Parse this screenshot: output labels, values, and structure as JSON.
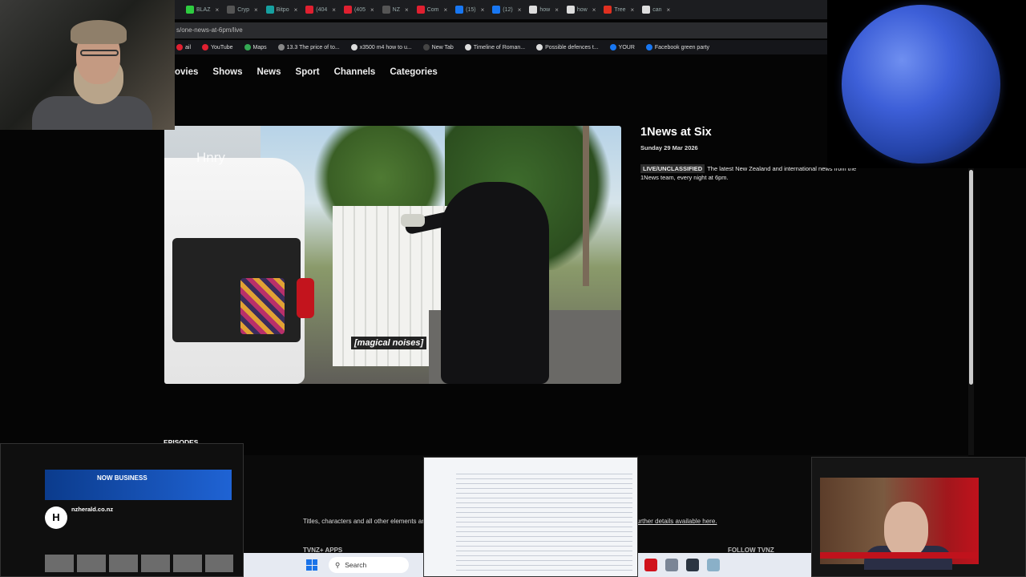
{
  "browser": {
    "tabs": [
      {
        "label": "BLAZ",
        "color": "#2ecc40"
      },
      {
        "label": "Cryp",
        "color": "#555555"
      },
      {
        "label": "Bitpo",
        "color": "#16a0a0"
      },
      {
        "label": "(404",
        "color": "#e02030"
      },
      {
        "label": "(405",
        "color": "#e02030"
      },
      {
        "label": "NZ",
        "color": "#555555"
      },
      {
        "label": "Com",
        "color": "#e02030"
      },
      {
        "label": "(15)",
        "color": "#1877f2"
      },
      {
        "label": "(12)",
        "color": "#1877f2"
      },
      {
        "label": "how",
        "color": "#dddddd"
      },
      {
        "label": "how",
        "color": "#dddddd"
      },
      {
        "label": "Tree",
        "color": "#e03020"
      },
      {
        "label": "can",
        "color": "#dddddd"
      }
    ],
    "url": "s/one-news-at-6pm/live",
    "bookmarks": [
      {
        "label": "ail",
        "color": "#e02030"
      },
      {
        "label": "YouTube",
        "color": "#e02030"
      },
      {
        "label": "Maps",
        "color": "#34a853"
      },
      {
        "label": "13.3 The price of to...",
        "color": "#888888"
      },
      {
        "label": "x3500 m4 how to u...",
        "color": "#dddddd"
      },
      {
        "label": "New Tab",
        "color": "#444444"
      },
      {
        "label": "Timeline of Roman...",
        "color": "#dddddd"
      },
      {
        "label": "Possible defences t...",
        "color": "#dddddd"
      },
      {
        "label": "YOUR",
        "color": "#1877f2"
      },
      {
        "label": "Facebook green party",
        "color": "#1877f2"
      }
    ]
  },
  "site": {
    "nav": [
      "ovies",
      "Shows",
      "News",
      "Sport",
      "Channels",
      "Categories"
    ],
    "player": {
      "brand": "Hnry",
      "subtitle": "[magical noises]"
    },
    "show": {
      "title": "1News at Six",
      "date": "Sunday 29 Mar 2026",
      "badge": "LIVE/UNCLASSIFIED",
      "description": "The latest New Zealand and international news from the 1News team, every night at 6pm."
    },
    "episodes_label": "EPISODES",
    "footer": {
      "legal": "Titles, characters and all other elements are",
      "legal_link": "urther details available here.",
      "apps_title": "TVNZ+ APPS",
      "follow_title": "FOLLOW TVNZ"
    }
  },
  "taskbar": {
    "search_placeholder": "Search"
  },
  "thumb_left": {
    "banner_title": "NOW BUSINESS",
    "channel_name": "nzherald.co.nz"
  }
}
